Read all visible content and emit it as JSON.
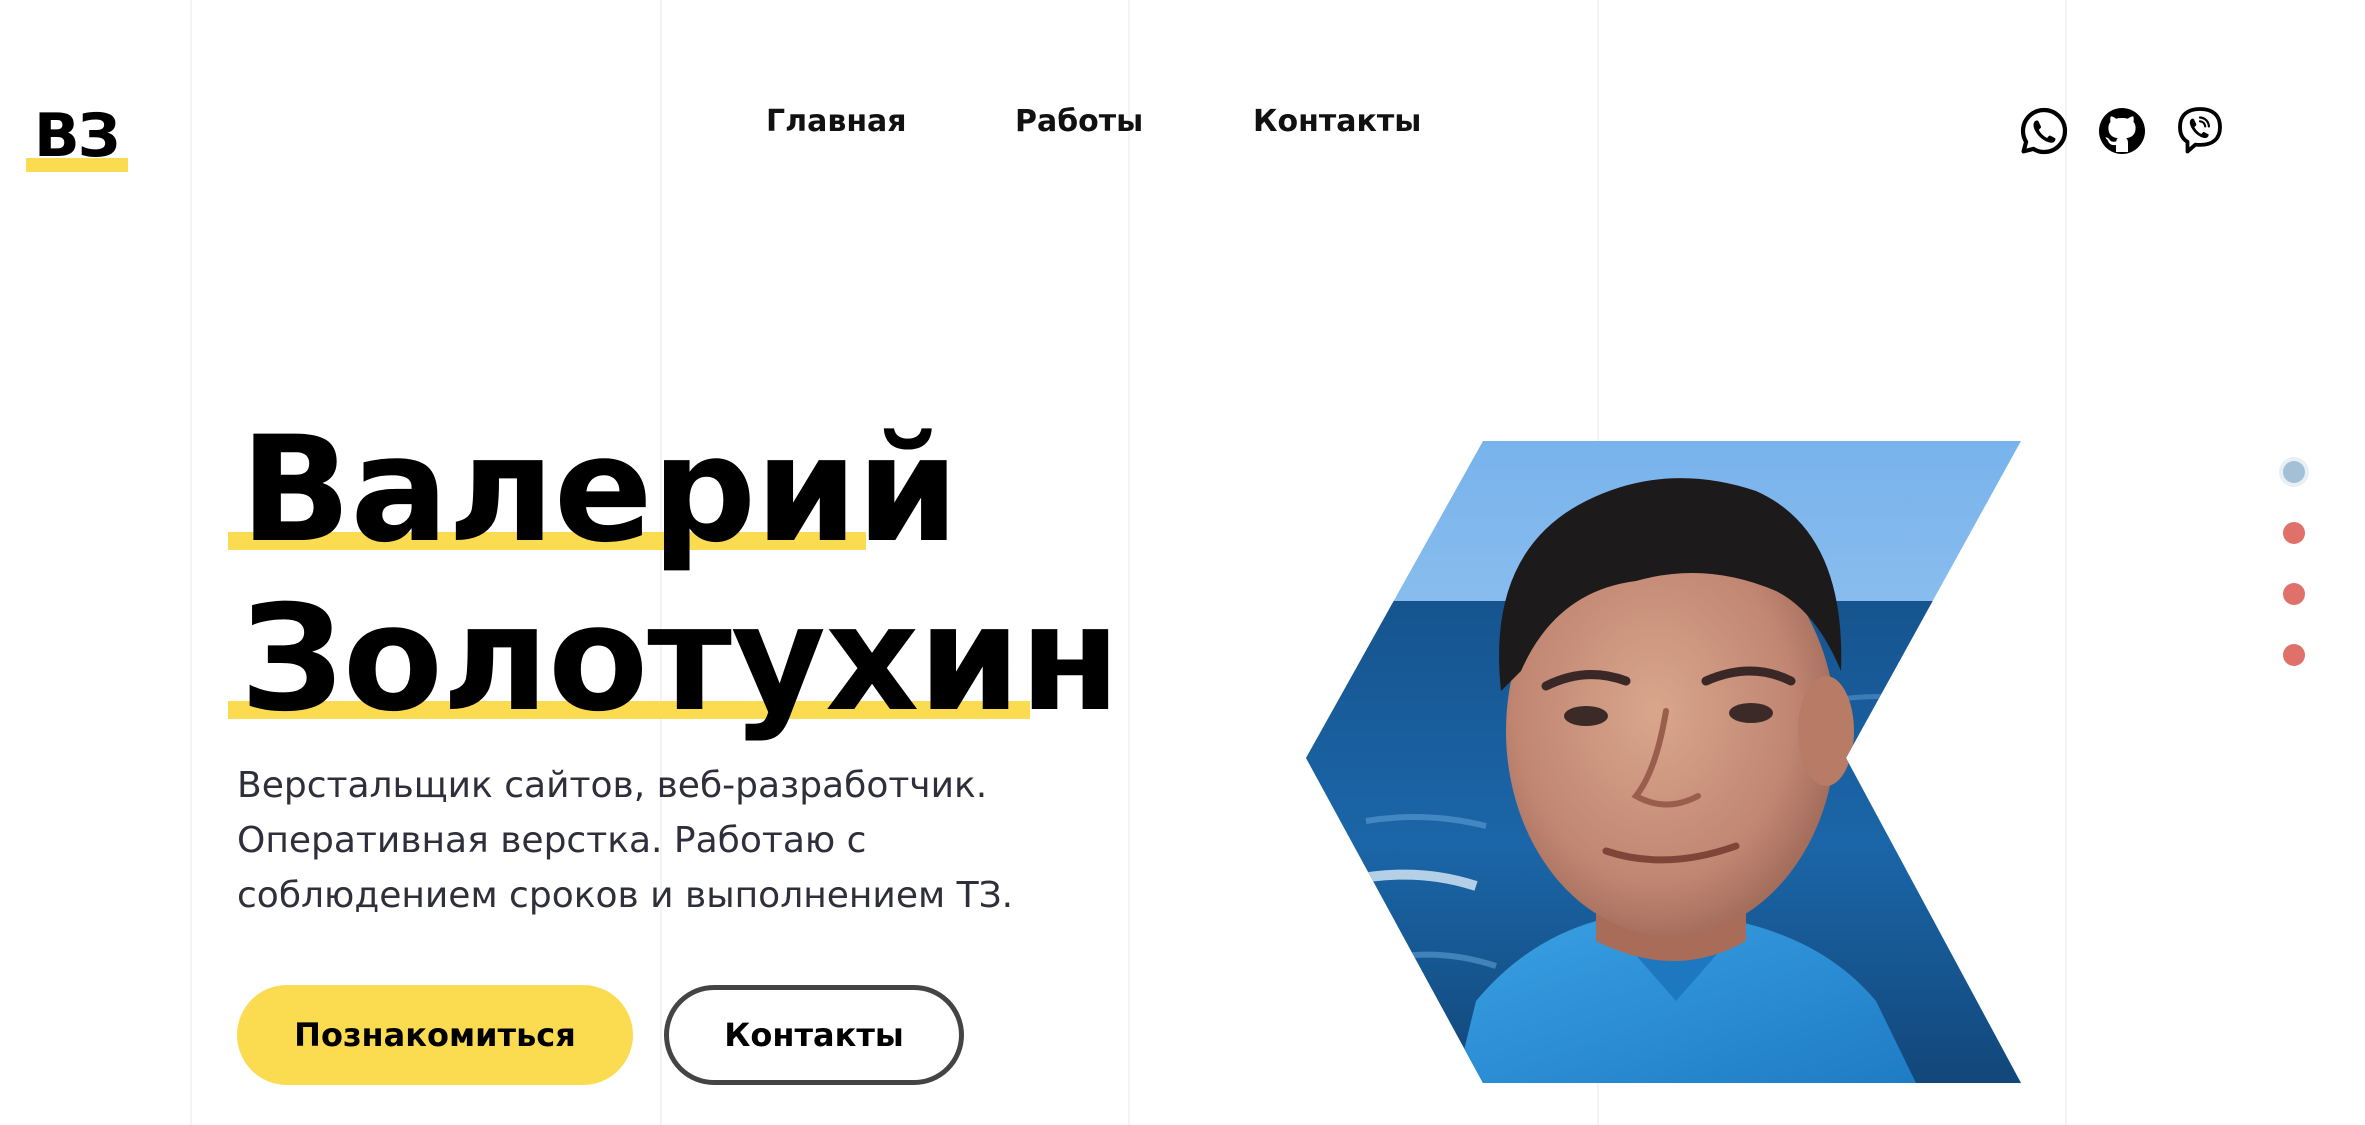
{
  "logo": {
    "text": "ВЗ"
  },
  "nav": {
    "items": [
      {
        "label": "Главная"
      },
      {
        "label": "Работы"
      },
      {
        "label": "Контакты"
      }
    ]
  },
  "social": [
    {
      "icon": "whatsapp-icon"
    },
    {
      "icon": "github-icon"
    },
    {
      "icon": "viber-icon"
    }
  ],
  "hero": {
    "name_line1": "Валерий",
    "name_line2": "Золотухин",
    "description": "Верстальщик сайтов, веб-разработчик. Оперативная верстка. Работаю с соблюдением сроков и выполнением ТЗ.",
    "primary_button": "Познакомиться",
    "secondary_button": "Контакты"
  },
  "pagination": {
    "active_index": 0,
    "count": 4
  },
  "colors": {
    "accent_yellow": "#fbdb4f",
    "dot_active": "#a3c0d6",
    "dot_inactive": "#e0706a",
    "text_dark": "#2f2f3b"
  }
}
